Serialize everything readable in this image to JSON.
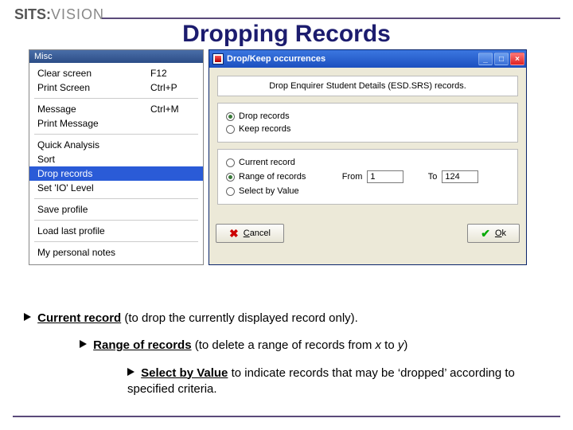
{
  "logo": {
    "part1": "SITS:",
    "part2": "VISION"
  },
  "title": "Dropping Records",
  "misc": {
    "title": "Misc",
    "items": [
      {
        "label": "Clear screen",
        "short": "F12"
      },
      {
        "label": "Print Screen",
        "short": "Ctrl+P"
      },
      {
        "sep": true
      },
      {
        "label": "Message",
        "short": "Ctrl+M"
      },
      {
        "label": "Print Message",
        "short": ""
      },
      {
        "sep": true
      },
      {
        "label": "Quick Analysis",
        "short": ""
      },
      {
        "label": "Sort",
        "short": ""
      },
      {
        "label": "Drop records",
        "short": "",
        "selected": true
      },
      {
        "label": "Set 'IO' Level",
        "short": ""
      },
      {
        "sep": true
      },
      {
        "label": "Save profile",
        "short": ""
      },
      {
        "sep": true
      },
      {
        "label": "Load last profile",
        "short": ""
      },
      {
        "sep": true
      },
      {
        "label": "My personal notes",
        "short": ""
      }
    ]
  },
  "dialog": {
    "title": "Drop/Keep occurrences",
    "message": "Drop Enquirer Student Details (ESD.SRS) records.",
    "mode": [
      {
        "label": "Drop records",
        "on": true
      },
      {
        "label": "Keep records",
        "on": false
      }
    ],
    "scope": [
      {
        "label": "Current record",
        "on": false
      },
      {
        "label": "Range of records",
        "on": true
      },
      {
        "label": "Select by Value",
        "on": false
      }
    ],
    "from_label": "From",
    "to_label": "To",
    "from_value": "1",
    "to_value": "124",
    "cancel": "Cancel",
    "ok": "Ok"
  },
  "bullets": {
    "b1a": "Current record",
    "b1b": " (to drop the currently displayed record only).",
    "b2a": "Range of records",
    "b2b": " (to delete a range of records from ",
    "b2x": "x",
    "b2c": " to ",
    "b2y": "y",
    "b2d": ")",
    "b3a": "Select by Value",
    "b3b": " to indicate records that may be ‘dropped’ according to specified criteria."
  }
}
